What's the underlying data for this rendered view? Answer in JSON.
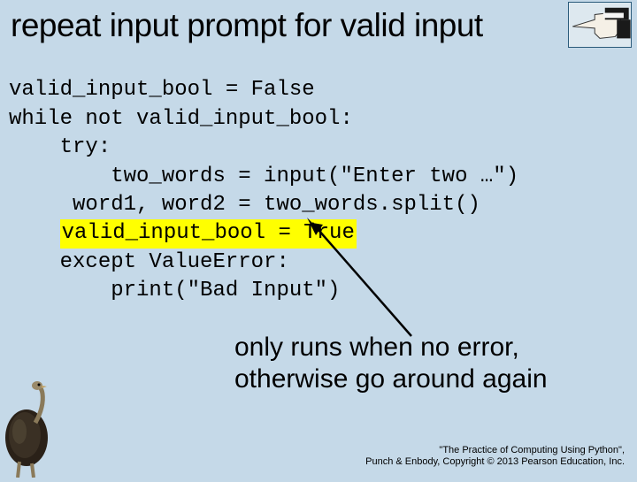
{
  "title": "repeat input prompt for valid input",
  "code": {
    "l1": "valid_input_bool = False",
    "l2": "while not valid_input_bool:",
    "l3": "    try:",
    "l4": "        two_words = input(\"Enter two …\")",
    "l5": "     word1, word2 = two_words.split()",
    "l6_hl": "valid_input_bool = True",
    "l7": "    except ValueError:",
    "l8": "        print(\"Bad Input\")"
  },
  "annotation": {
    "line1": "only runs when no error,",
    "line2": "otherwise go around again"
  },
  "footer": {
    "line1": "\"The Practice of Computing Using Python\",",
    "line2": "Punch & Enbody, Copyright © 2013 Pearson Education, Inc."
  }
}
